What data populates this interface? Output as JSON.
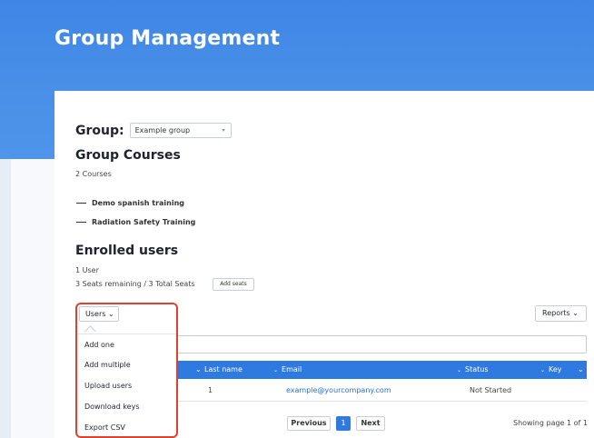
{
  "page": {
    "title": "Group Management"
  },
  "group": {
    "label": "Group:",
    "selected": "Example group",
    "caret_icon": "▾"
  },
  "courses": {
    "heading": "Group Courses",
    "count": "2 Courses",
    "items": [
      "Demo spanish training",
      "Radiation Safety Training"
    ]
  },
  "enrolled": {
    "heading": "Enrolled users",
    "user_count": "1 User",
    "seats": "3 Seats remaining / 3 Total Seats",
    "add_seats_label": "Add seats"
  },
  "toolbar": {
    "users_label": "Users ⌄",
    "reports_label": "Reports ⌄"
  },
  "users_menu": {
    "items": [
      "Add one",
      "Add multiple",
      "Upload users",
      "Download keys",
      "Export CSV"
    ]
  },
  "table": {
    "headers": {
      "first_arrow": "⌄",
      "last_name": "Last name",
      "email": "Email",
      "status": "Status",
      "key": "Key"
    },
    "row": {
      "last_name": "1",
      "email": "example@yourcompany.com",
      "status": "Not Started"
    }
  },
  "pagination": {
    "previous": "Previous",
    "page": "1",
    "next": "Next",
    "showing": "Showing page 1 of 1"
  },
  "colors": {
    "banner": "#4a90e8",
    "header_blue": "#2f7ae0",
    "menu_highlight": "#e0412c",
    "link": "#2f6fd1"
  }
}
